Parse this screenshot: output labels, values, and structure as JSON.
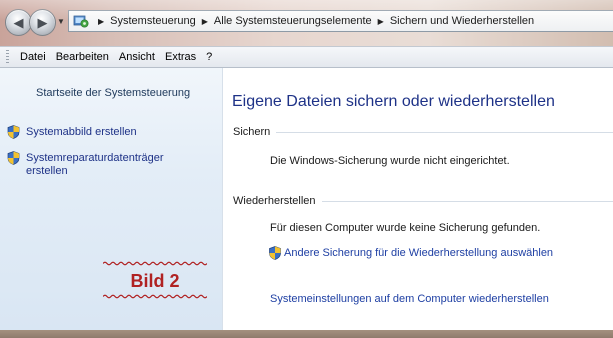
{
  "window": {
    "breadcrumbs": [
      "Systemsteuerung",
      "Alle Systemsteuerungselemente",
      "Sichern und Wiederherstellen"
    ]
  },
  "menubar": {
    "items": [
      "Datei",
      "Bearbeiten",
      "Ansicht",
      "Extras",
      "?"
    ]
  },
  "sidebar": {
    "home_link": "Startseite der Systemsteuerung",
    "items": [
      {
        "label": "Systemabbild erstellen",
        "icon": "uac-shield-icon"
      },
      {
        "label": "Systemreparaturdatenträger erstellen",
        "icon": "uac-shield-icon"
      }
    ]
  },
  "stamp": {
    "text": "Bild 2",
    "color": "#b02222"
  },
  "main": {
    "title": "Eigene Dateien sichern oder wiederherstellen",
    "backup_section": {
      "heading": "Sichern",
      "status": "Die Windows-Sicherung wurde nicht eingerichtet."
    },
    "restore_section": {
      "heading": "Wiederherstellen",
      "status": "Für diesen Computer wurde keine Sicherung gefunden.",
      "other_backup_link": "Andere Sicherung für die Wiederherstellung auswählen",
      "system_restore_link": "Systemeinstellungen auf dem Computer wiederherstellen"
    }
  },
  "colors": {
    "link": "#1e3fa3",
    "title": "#1e3287",
    "stamp": "#b02222"
  }
}
